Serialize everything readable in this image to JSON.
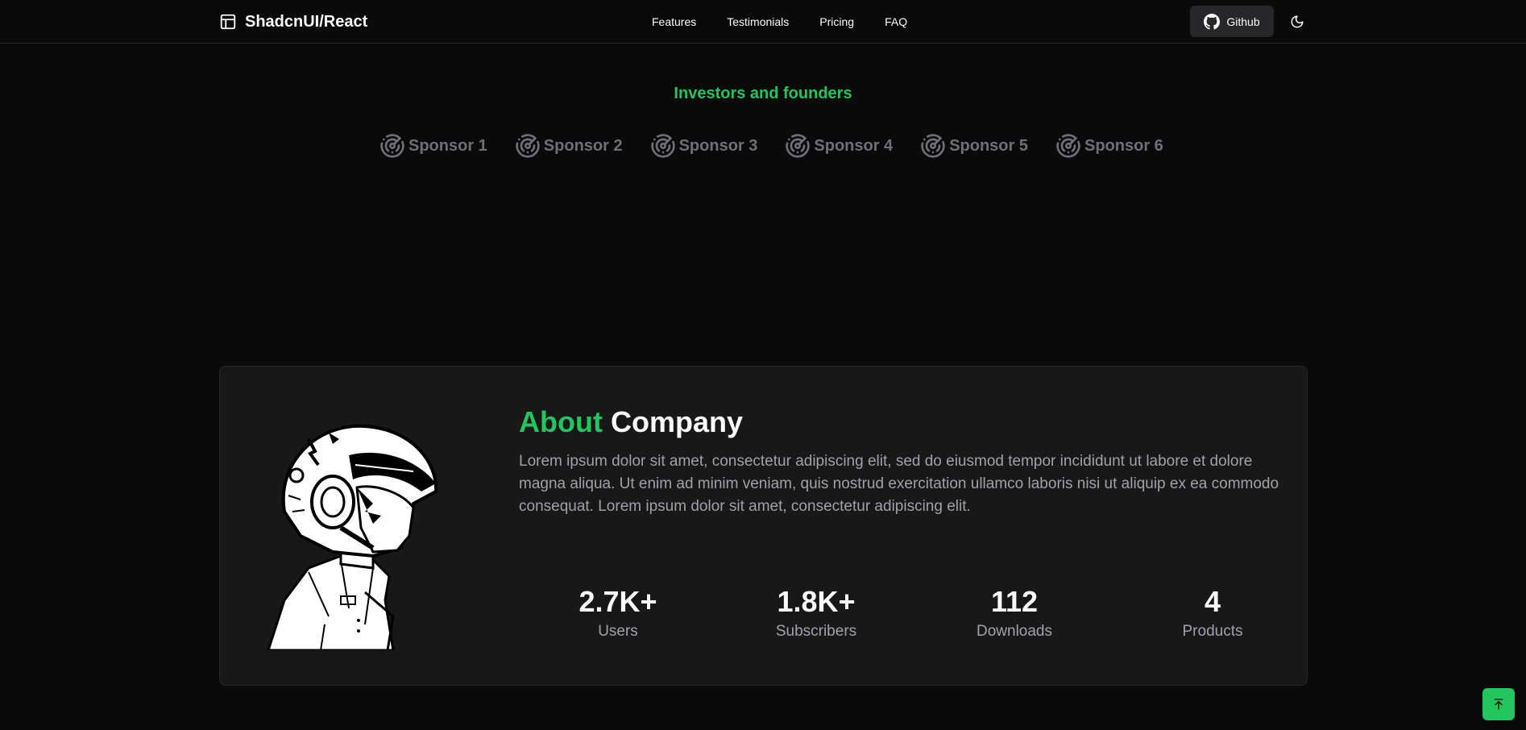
{
  "navbar": {
    "brand": "ShadcnUI/React",
    "links": [
      "Features",
      "Testimonials",
      "Pricing",
      "FAQ"
    ],
    "github_label": "Github"
  },
  "sponsors": {
    "title": "Investors and founders",
    "items": [
      "Sponsor 1",
      "Sponsor 2",
      "Sponsor 3",
      "Sponsor 4",
      "Sponsor 5",
      "Sponsor 6"
    ]
  },
  "about": {
    "heading_accent": "About",
    "heading_rest": "Company",
    "text": "Lorem ipsum dolor sit amet, consectetur adipiscing elit, sed do eiusmod tempor incididunt ut labore et dolore magna aliqua. Ut enim ad minim veniam, quis nostrud exercitation ullamco laboris nisi ut aliquip ex ea commodo consequat. Lorem ipsum dolor sit amet, consectetur adipiscing elit.",
    "stats": [
      {
        "value": "2.7K+",
        "label": "Users"
      },
      {
        "value": "1.8K+",
        "label": "Subscribers"
      },
      {
        "value": "112",
        "label": "Downloads"
      },
      {
        "value": "4",
        "label": "Products"
      }
    ]
  },
  "colors": {
    "accent": "#22c55e",
    "background": "#0a0a0a",
    "card": "#181818",
    "muted_text": "#a1a1aa"
  },
  "icons": {
    "brand": "panel-left-icon",
    "github": "github-icon",
    "theme": "moon-icon",
    "sponsor": "radar-icon",
    "scroll_top": "arrow-up-to-line-icon"
  }
}
